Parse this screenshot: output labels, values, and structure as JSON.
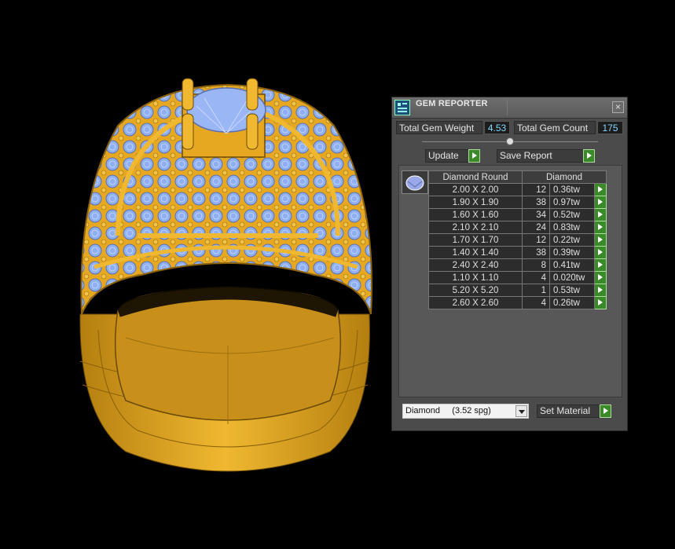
{
  "colors": {
    "gold": "#e6a821",
    "gem_blue": "#8fb0f0",
    "panel_bg": "#4b4b4b",
    "accent_green": "#3a8a2a",
    "value_text": "#7fd8ff"
  },
  "viewport": {
    "subject": "ring-wireframe"
  },
  "panel": {
    "title": "GEM REPORTER",
    "logo_icon": "gem-reporter-logo-icon",
    "close_icon": "close-icon",
    "total_weight_label": "Total Gem Weight",
    "total_weight_value": "4.53",
    "total_count_label": "Total Gem Count",
    "total_count_value": "175",
    "update_label": "Update",
    "save_label": "Save Report",
    "table": {
      "col_shape": "Diamond Round",
      "col_material": "Diamond",
      "rows": [
        {
          "size": "2.00 X 2.00",
          "count": "12",
          "weight": "0.36tw"
        },
        {
          "size": "1.90 X 1.90",
          "count": "38",
          "weight": "0.97tw"
        },
        {
          "size": "1.60 X 1.60",
          "count": "34",
          "weight": "0.52tw"
        },
        {
          "size": "2.10 X 2.10",
          "count": "24",
          "weight": "0.83tw"
        },
        {
          "size": "1.70 X 1.70",
          "count": "12",
          "weight": "0.22tw"
        },
        {
          "size": "1.40 X 1.40",
          "count": "38",
          "weight": "0.39tw"
        },
        {
          "size": "2.40 X 2.40",
          "count": "8",
          "weight": "0.41tw"
        },
        {
          "size": "1.10 X 1.10",
          "count": "4",
          "weight": "0.020tw"
        },
        {
          "size": "5.20 X 5.20",
          "count": "1",
          "weight": "0.53tw"
        },
        {
          "size": "2.60 X 2.60",
          "count": "4",
          "weight": "0.26tw"
        }
      ]
    },
    "material_select": "Diamond     (3.52 spg)",
    "set_material_label": "Set Material"
  }
}
